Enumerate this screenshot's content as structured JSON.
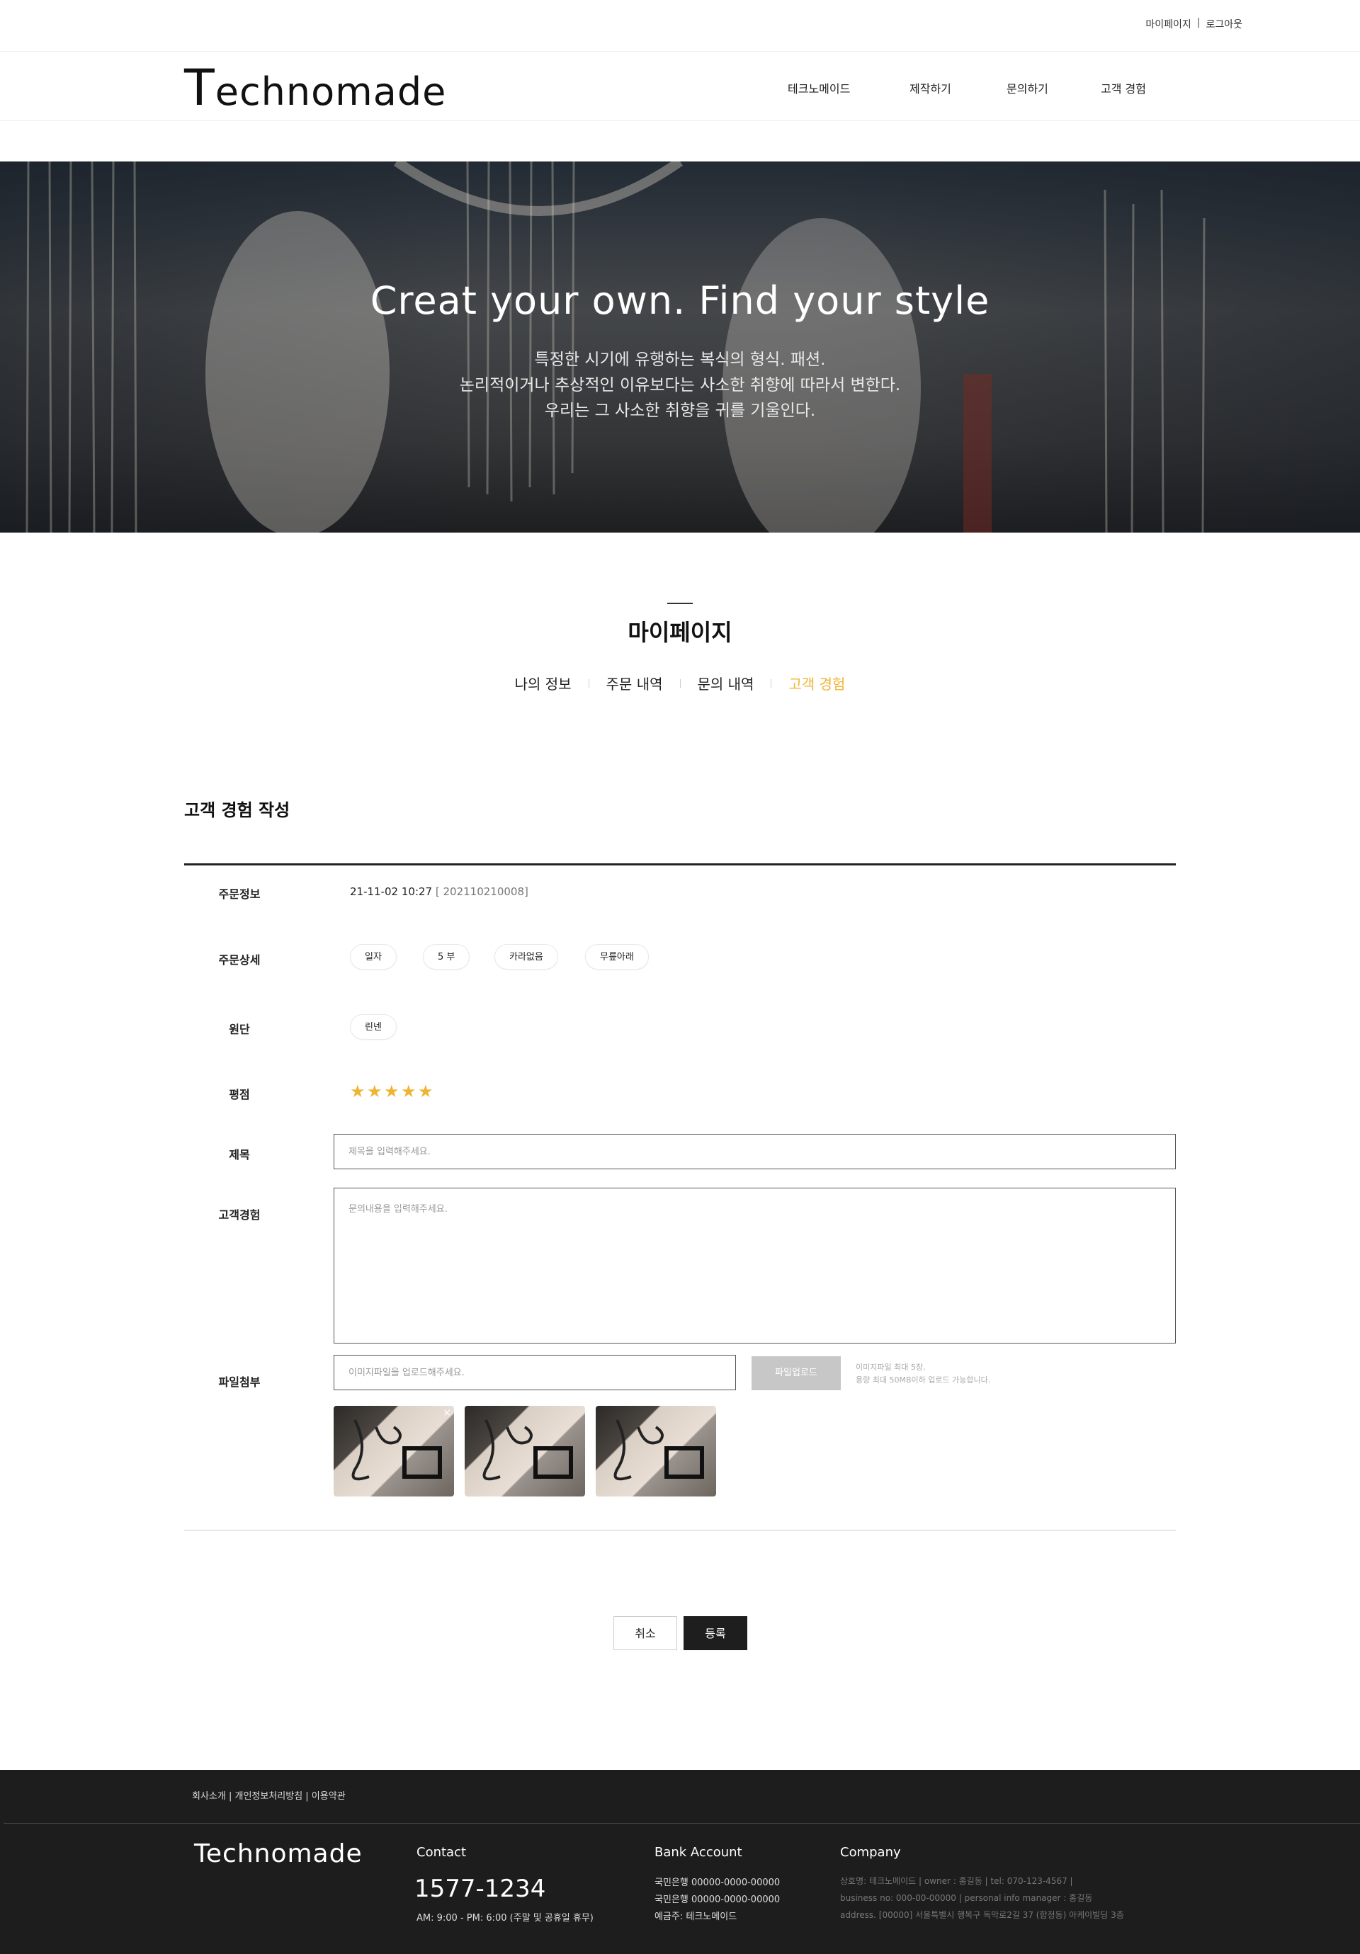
{
  "topbar": {
    "mypage": "마이페이지",
    "separator": "|",
    "logout": "로그아웃"
  },
  "header": {
    "logo_first": "T",
    "logo_rest": "echnomade",
    "nav": [
      "테크노메이드",
      "제작하기",
      "문의하기",
      "고객 경험"
    ]
  },
  "hero": {
    "title": "Creat your own. Find your style",
    "lines": [
      "특정한 시기에 유행하는 복식의 형식. 패션.",
      "논리적이거나 추상적인 이유보다는 사소한 취향에 따라서 변한다.",
      "우리는 그 사소한 취향을 귀를 기울인다."
    ]
  },
  "page": {
    "title": "마이페이지",
    "tabs": [
      {
        "label": "나의 정보",
        "active": false
      },
      {
        "label": "주문 내역",
        "active": false
      },
      {
        "label": "문의 내역",
        "active": false
      },
      {
        "label": "고객 경험",
        "active": true
      }
    ],
    "active_color": "#f0b433"
  },
  "form": {
    "section_title": "고객 경험 작성",
    "order_info_label": "주문정보",
    "order_date": "21-11-02 10:27",
    "order_number": "[ 202110210008]",
    "order_detail_label": "주문상세",
    "order_details": [
      "일자",
      "5 부",
      "카라없음",
      "무릎아래"
    ],
    "fabric_label": "원단",
    "fabric": "린넨",
    "rating_label": "평점",
    "rating": 5,
    "rating_max": 5,
    "star_color": "#f0b433",
    "title_label": "제목",
    "title_placeholder": "제목을 입력해주세요.",
    "experience_label": "고객경험",
    "experience_placeholder": "문의내용을 입력해주세요.",
    "file_label": "파일첨부",
    "file_placeholder": "이미지파일을 업로드해주세요.",
    "upload_button": "파일업로드",
    "upload_note_1": "이미지파일 최대 5장,",
    "upload_note_2": "용량 최대 50MB이하 업로드 가능합니다.",
    "thumbnails": [
      {
        "icon": "style-photo-thumbnail",
        "close": "×"
      },
      {
        "icon": "style-photo-thumbnail"
      },
      {
        "icon": "style-photo-thumbnail"
      }
    ]
  },
  "actions": {
    "cancel": "취소",
    "submit": "등록"
  },
  "footer": {
    "links": "회사소개 | 개인정보처리방침 | 이용약관",
    "logo": "Technomade",
    "contact_title": "Contact",
    "phone": "1577-1234",
    "hours": "AM: 9:00 - PM: 6:00 (주말 및 공휴일 휴무)",
    "bank_title": "Bank Account",
    "bank_lines": [
      "국민은행 00000-0000-00000",
      "국민은행 00000-0000-00000",
      "예금주:    테크노메이드"
    ],
    "company_title": "Company",
    "company_lines": [
      "상호명: 테크노메이드 |   owner : 홍길동 |   tel: 070-123-4567 |",
      "business no: 000-00-00000 | personal info manager : 홍길동",
      "address. [00000] 서울특별시 행복구 독막로2길 37 (합정동) 아케이빌딩 3층"
    ]
  }
}
